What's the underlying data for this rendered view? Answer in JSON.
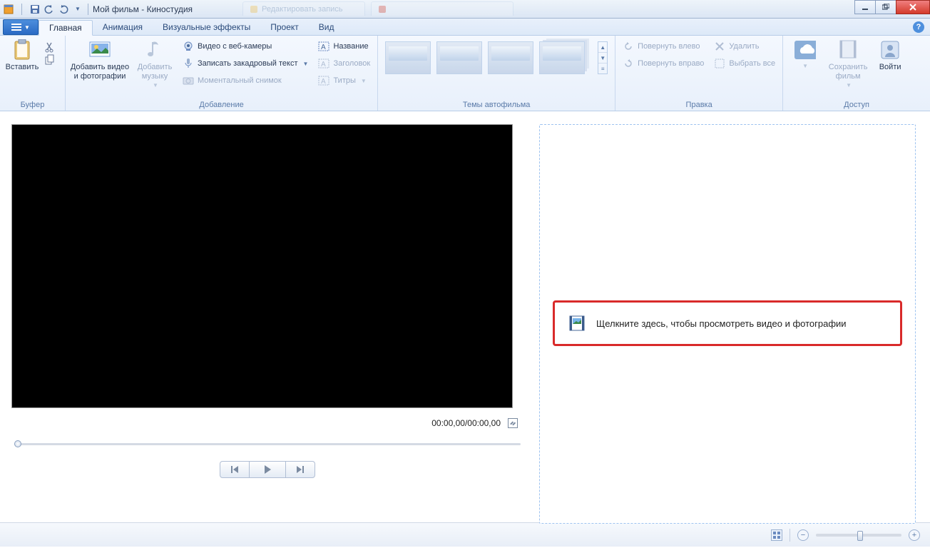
{
  "titlebar": {
    "title": "Мой фильм - Киностудия"
  },
  "bg_tabs": [
    {
      "label": "Редактировать запись",
      "color": "#f4c04a"
    },
    {
      "label": "",
      "color": "#d84a3a"
    }
  ],
  "tabs": {
    "main": "Главная",
    "animation": "Анимация",
    "visual_effects": "Визуальные эффекты",
    "project": "Проект",
    "view": "Вид"
  },
  "ribbon": {
    "clipboard": {
      "paste": "Вставить",
      "group": "Буфер"
    },
    "add": {
      "add_videos_photos": "Добавить видео и фотографии",
      "add_music": "Добавить музыку",
      "webcam_video": "Видео с веб-камеры",
      "record_narration": "Записать закадровый текст",
      "snapshot": "Моментальный снимок",
      "title": "Название",
      "caption": "Заголовок",
      "credits": "Титры",
      "group": "Добавление"
    },
    "automovie": {
      "group": "Темы автофильма"
    },
    "editing": {
      "rotate_left": "Повернуть влево",
      "rotate_right": "Повернуть вправо",
      "delete": "Удалить",
      "select_all": "Выбрать все",
      "group": "Правка"
    },
    "share": {
      "save_movie": "Сохранить фильм",
      "sign_in": "Войти",
      "group": "Доступ"
    }
  },
  "player": {
    "time": "00:00,00/00:00,00"
  },
  "timeline": {
    "placeholder": "Щелкните здесь, чтобы просмотреть видео и фотографии"
  }
}
